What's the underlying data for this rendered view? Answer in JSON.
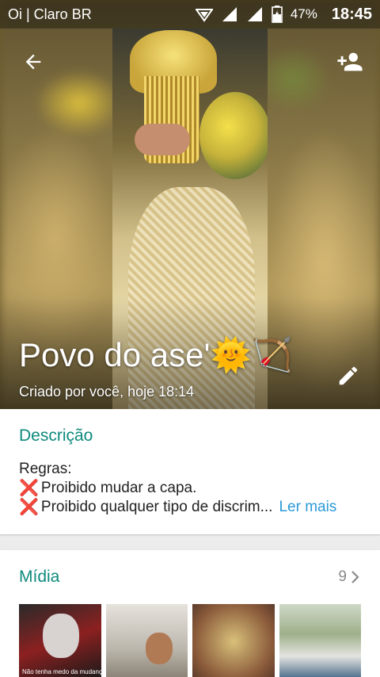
{
  "status_bar": {
    "carrier": "Oi | Claro BR",
    "battery_percent": "47%",
    "time": "18:45"
  },
  "header": {
    "group_name": "Povo do ase'🌞🏹",
    "created_info": "Criado por você, hoje 18:14"
  },
  "description": {
    "title": "Descrição",
    "line1": "Regras:",
    "rule1_mark": "❌",
    "rule1": "Proibido mudar a capa.",
    "rule2_mark": "❌",
    "rule2": "Proibido qualquer tipo de discrim...",
    "read_more": "Ler mais"
  },
  "media": {
    "title": "Mídia",
    "count": "9",
    "thumb1_caption": "Não tenha medo da mudança"
  },
  "colors": {
    "accent": "#0e8a7d",
    "link": "#2a9bd8",
    "rule_mark": "#d11a1a"
  },
  "icons": {
    "back": "arrow-left-icon",
    "add_participant": "person-add-icon",
    "edit": "pencil-icon"
  }
}
